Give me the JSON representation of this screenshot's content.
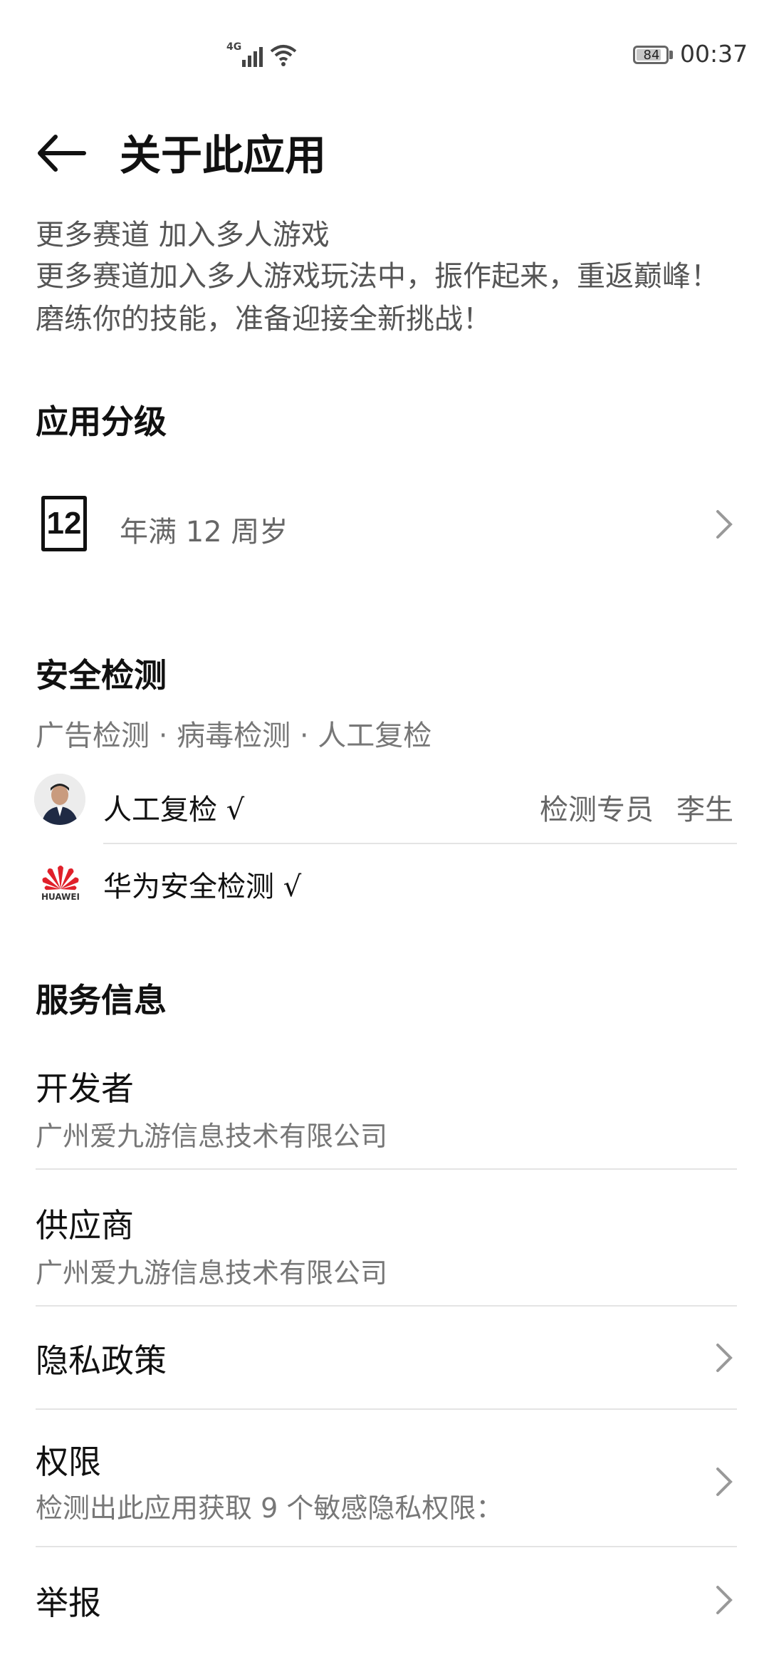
{
  "status_bar": {
    "network": "4G",
    "battery": "84",
    "time": "00:37"
  },
  "header": {
    "title": "关于此应用"
  },
  "description": {
    "line1": "更多赛道 加入多人游戏",
    "line2": "更多赛道加入多人游戏玩法中，振作起来，重返巅峰！磨练你的技能，准备迎接全新挑战！"
  },
  "rating_section": {
    "heading": "应用分级",
    "icon_label": "12",
    "text": "年满 12 周岁"
  },
  "security_section": {
    "heading": "安全检测",
    "checks": "广告检测 · 病毒检测 · 人工复检",
    "manual_review": "人工复检 √",
    "inspector_label": "检测专员",
    "inspector_name": "李生",
    "huawei_check": "华为安全检测 √",
    "huawei_logo_text": "HUAWEI"
  },
  "service_section": {
    "heading": "服务信息",
    "developer_label": "开发者",
    "developer_value": "广州爱九游信息技术有限公司",
    "provider_label": "供应商",
    "provider_value": "广州爱九游信息技术有限公司",
    "privacy_label": "隐私政策",
    "permissions_label": "权限",
    "permissions_desc": "检测出此应用获取 9 个敏感隐私权限：",
    "report_label": "举报"
  },
  "icons": [
    "back-arrow-icon",
    "signal-icon",
    "wifi-icon",
    "battery-icon",
    "chevron-right-icon",
    "rating-12-icon",
    "avatar",
    "huawei-logo-icon"
  ],
  "colors": {
    "text": "#111111",
    "secondary": "#777777",
    "divider": "#e4e4e4",
    "huawei_red": "#e0202a"
  }
}
